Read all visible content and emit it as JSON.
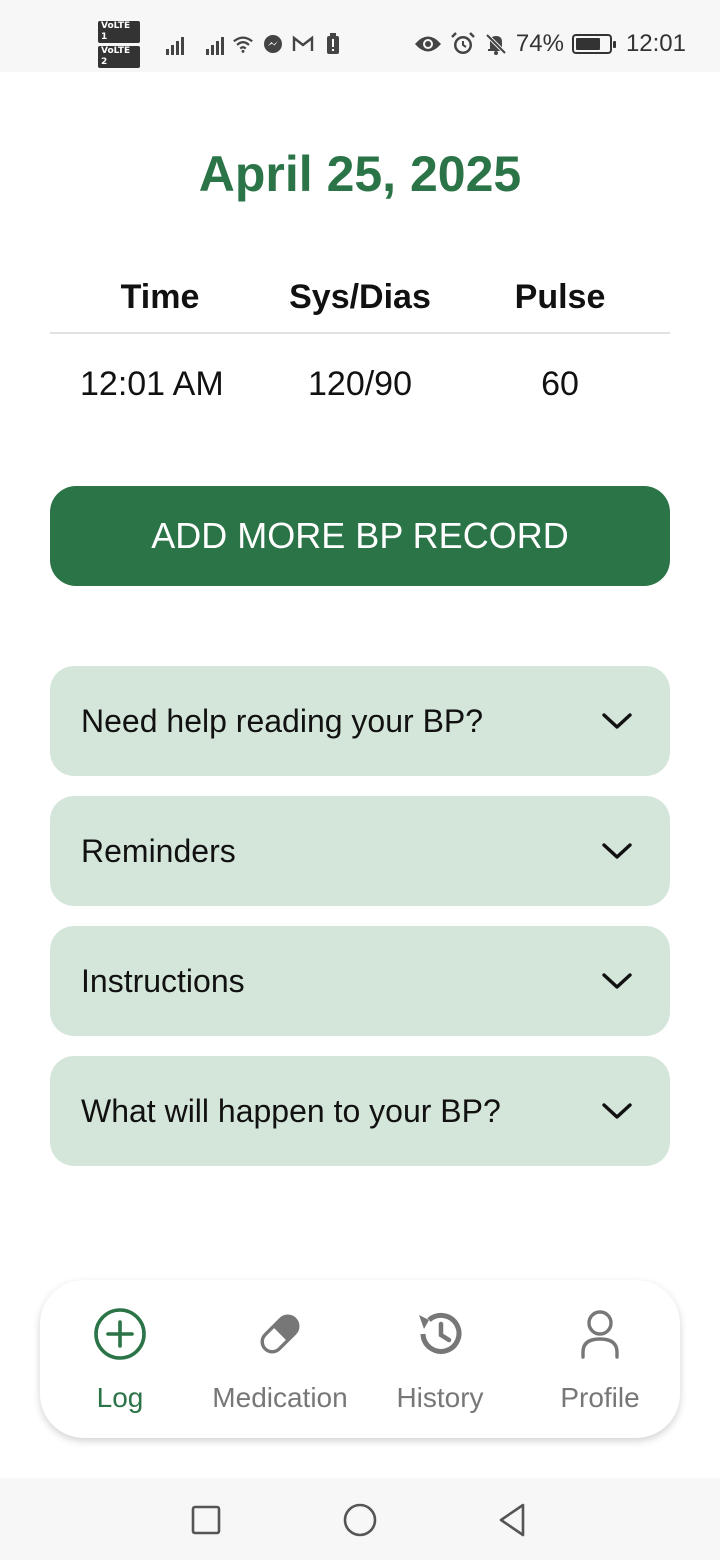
{
  "status_bar": {
    "volte1": "VoLTE 1",
    "volte2": "VoLTE 2",
    "battery_percent": "74%",
    "battery_level": 0.74,
    "time": "12:01",
    "icons": [
      "signal-icon",
      "signal-icon",
      "wifi-icon",
      "messenger-icon",
      "gmail-icon",
      "battery-alert-icon",
      "eye-icon",
      "alarm-icon",
      "bell-off-icon",
      "battery-icon"
    ]
  },
  "header": {
    "date": "April 25, 2025"
  },
  "table": {
    "headers": {
      "time": "Time",
      "sys_dias": "Sys/Dias",
      "pulse": "Pulse"
    },
    "rows": [
      {
        "time": "12:01 AM",
        "sys_dias": "120/90",
        "pulse": "60"
      }
    ]
  },
  "add_button": {
    "label": "ADD MORE BP RECORD"
  },
  "accordions": [
    {
      "label": "Need help reading your BP?"
    },
    {
      "label": "Reminders"
    },
    {
      "label": "Instructions"
    },
    {
      "label": "What will happen to your BP?"
    }
  ],
  "bottom_nav": {
    "items": [
      {
        "label": "Log",
        "icon": "plus-circle-icon",
        "active": true
      },
      {
        "label": "Medication",
        "icon": "pill-icon",
        "active": false
      },
      {
        "label": "History",
        "icon": "history-icon",
        "active": false
      },
      {
        "label": "Profile",
        "icon": "person-icon",
        "active": false
      }
    ]
  },
  "colors": {
    "primary": "#2b7447",
    "accordion_bg": "#d4e5da",
    "nav_inactive": "#777777"
  }
}
